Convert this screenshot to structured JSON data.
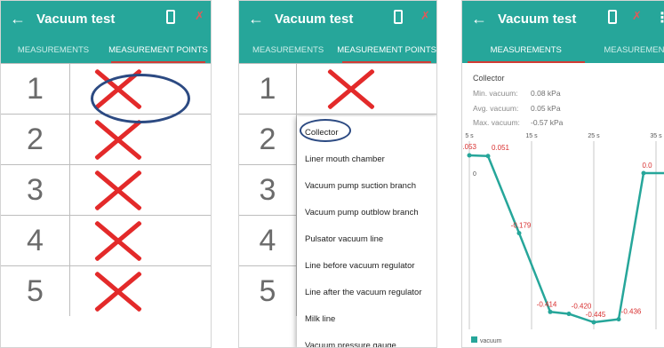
{
  "app": {
    "title": "Vacuum test",
    "back_icon": "arrow-left-icon",
    "battery_icon": "battery-icon",
    "bluetooth_icon": "bluetooth-icon",
    "more_icon": "more-vert-icon",
    "accent_color": "#26a69a",
    "bluetooth_color": "#e05a5a"
  },
  "tabs": {
    "measurements": "MEASUREMENTS",
    "measurement_points": "MEASUREMENT POINTS"
  },
  "points": [
    {
      "number": "1",
      "status": "not-measured",
      "status_icon": "x-icon"
    },
    {
      "number": "2",
      "status": "not-measured",
      "status_icon": "x-icon"
    },
    {
      "number": "3",
      "status": "not-measured",
      "status_icon": "x-icon"
    },
    {
      "number": "4",
      "status": "not-measured",
      "status_icon": "x-icon"
    },
    {
      "number": "5",
      "status": "not-measured",
      "status_icon": "x-icon"
    }
  ],
  "point_menu": {
    "items": [
      "Collector",
      "Liner mouth chamber",
      "Vacuum pump suction branch",
      "Vacuum pump outblow branch",
      "Pulsator vacuum line",
      "Line before vacuum regulator",
      "Line after the vacuum regulator",
      "Milk line",
      "Vacuum pressure gauge"
    ],
    "highlighted": "Collector"
  },
  "measurement": {
    "point_name": "Collector",
    "min_label": "Min. vacuum:",
    "min_value": "0.08 kPa",
    "avg_label": "Avg. vacuum:",
    "avg_value": "0.05 kPa",
    "max_label": "Max. vacuum:",
    "max_value": "-0.57 kPa"
  },
  "chart_data": {
    "type": "line",
    "title": "",
    "x_ticks": [
      "5 s",
      "15 s",
      "25 s",
      "35 s"
    ],
    "y_ticks": [
      "0"
    ],
    "series": [
      {
        "name": "vacuum",
        "color": "#26a69a",
        "x": [
          5,
          8,
          13,
          18,
          21,
          25,
          29,
          33,
          38
        ],
        "y": [
          0.053,
          0.051,
          -0.179,
          -0.414,
          -0.42,
          -0.445,
          -0.436,
          0.0,
          0.0
        ],
        "labels": [
          "0.053",
          "0.051",
          "-0.179",
          "-0.414",
          "-0.420",
          "-0.445",
          "-0.436",
          "0.0",
          ""
        ]
      }
    ],
    "legend": "bottom-left"
  }
}
